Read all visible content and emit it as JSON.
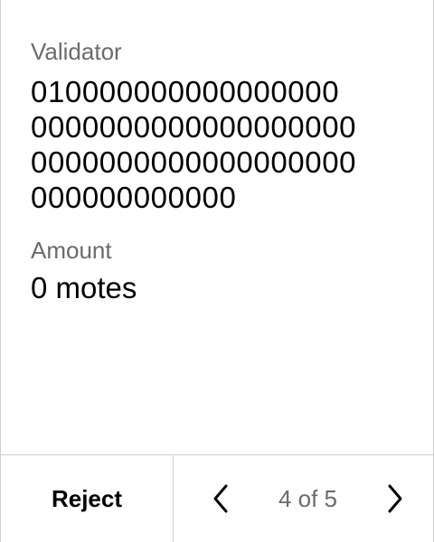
{
  "validator": {
    "label": "Validator",
    "value_lines": [
      "010000000000000000",
      "0000000000000000000",
      "0000000000000000000",
      "000000000000"
    ]
  },
  "amount": {
    "label": "Amount",
    "value": "0 motes"
  },
  "footer": {
    "reject_label": "Reject",
    "page_indicator": "4 of 5",
    "prev_icon": "chevron-left-icon",
    "next_icon": "chevron-right-icon"
  },
  "colors": {
    "primary_text": "#000000",
    "secondary_text": "#6b6b6b",
    "divider": "#cfcfcf",
    "background": "#ffffff"
  }
}
